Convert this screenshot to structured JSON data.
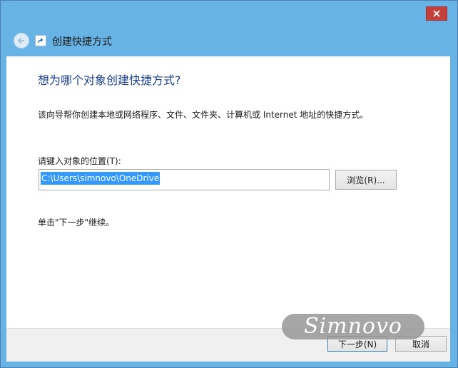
{
  "window": {
    "nav_title": "创建快捷方式",
    "accent_color": "#68b3e6",
    "close_color": "#c4403a"
  },
  "icons": {
    "close": "close-icon",
    "back": "back-arrow-icon",
    "shortcut": "shortcut-icon"
  },
  "content": {
    "heading": "想为哪个对象创建快捷方式?",
    "description": "该向导帮你创建本地或网络程序、文件、文件夹、计算机或 Internet 地址的快捷方式。",
    "location_label": "请键入对象的位置(T):",
    "location_value": "C:\\Users\\simnovo\\OneDrive",
    "browse_label": "浏览(R)...",
    "hint": "单击\"下一步\"继续。"
  },
  "footer": {
    "next_label": "下一步(N)",
    "cancel_label": "取消"
  },
  "watermark": "Simnovo"
}
